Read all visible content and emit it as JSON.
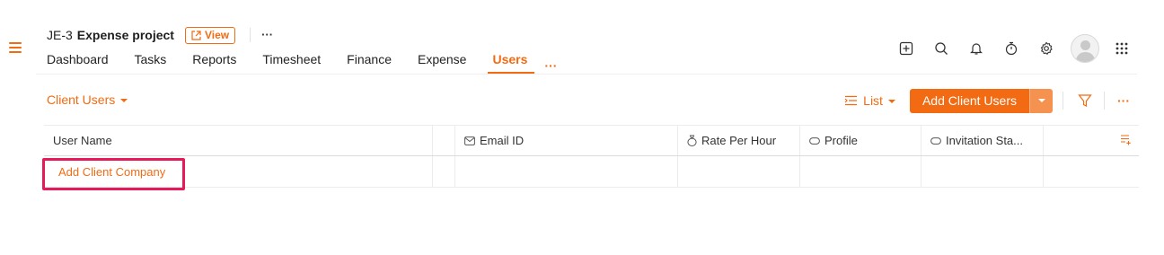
{
  "project": {
    "id": "JE-3",
    "name": "Expense project",
    "view_label": "View",
    "more": "···"
  },
  "tabs": [
    {
      "label": "Dashboard"
    },
    {
      "label": "Tasks"
    },
    {
      "label": "Reports"
    },
    {
      "label": "Timesheet"
    },
    {
      "label": "Finance"
    },
    {
      "label": "Expense"
    },
    {
      "label": "Users",
      "active": true
    }
  ],
  "tabs_more": "···",
  "top_icons": [
    "add-icon",
    "search-icon",
    "bell-icon",
    "timer-icon",
    "gear-icon",
    "avatar",
    "apps-grid-icon"
  ],
  "subheader": {
    "filter_label": "Client Users"
  },
  "toolbar": {
    "list_label": "List",
    "add_label": "Add Client Users",
    "more": "···"
  },
  "table": {
    "columns": [
      {
        "label": "User Name",
        "icon": ""
      },
      {
        "label": "",
        "icon": ""
      },
      {
        "label": "Email ID",
        "icon": "mail-icon"
      },
      {
        "label": "Rate Per Hour",
        "icon": "money-bag-icon"
      },
      {
        "label": "Profile",
        "icon": "tag-icon"
      },
      {
        "label": "Invitation Sta...",
        "icon": "tag-icon"
      },
      {
        "label": "",
        "icon": "column-settings-icon"
      }
    ],
    "rows": [
      {
        "user_name": "Add Client Company"
      }
    ]
  },
  "colors": {
    "accent": "#f26b13",
    "highlight": "#e8195a"
  }
}
